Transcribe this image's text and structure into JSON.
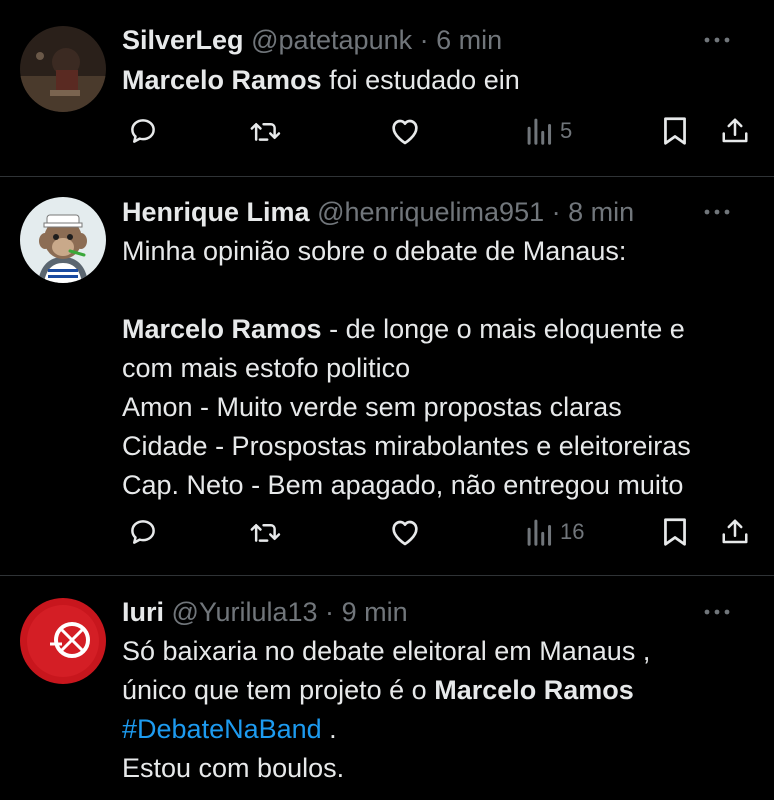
{
  "tweets": [
    {
      "name": "SilverLeg",
      "handle": "@patetapunk",
      "separator": "·",
      "time": "6 min",
      "text_bold": "Marcelo Ramos",
      "text_rest": " foi estudado ein",
      "views": "5"
    },
    {
      "name": "Henrique Lima",
      "handle": "@henriquelima951",
      "separator": "·",
      "time": "8 min",
      "line1": "Minha opinião sobre o debate de Manaus:",
      "line2_bold": "Marcelo Ramos",
      "line2_rest": " - de longe o mais eloquente e",
      "line3": "com mais estofo politico",
      "line4": "Amon - Muito verde sem propostas claras",
      "line5": "Cidade - Prospostas mirabolantes e eleitoreiras",
      "line6": "Cap. Neto - Bem apagado, não entregou muito",
      "views": "16"
    },
    {
      "name": "Iuri",
      "handle": "@Yurilula13",
      "separator": "·",
      "time": "9 min",
      "line1": "Só baixaria no debate eleitoral em Manaus ,",
      "line2_pre": "único que tem projeto é o ",
      "line2_bold": "Marcelo Ramos",
      "line3_hashtag": "#DebateNaBand",
      "line3_rest": " .",
      "line4": "Estou com boulos."
    }
  ],
  "icons": {
    "reply": "reply-icon",
    "retweet": "retweet-icon",
    "like": "heart-icon",
    "views": "views-icon",
    "bookmark": "bookmark-icon",
    "share": "share-icon",
    "more": "more-icon"
  },
  "colors": {
    "background": "#000000",
    "text": "#e7e9ea",
    "muted": "#71767b",
    "divider": "#2f3336",
    "hashtag": "#1d9bf0"
  }
}
